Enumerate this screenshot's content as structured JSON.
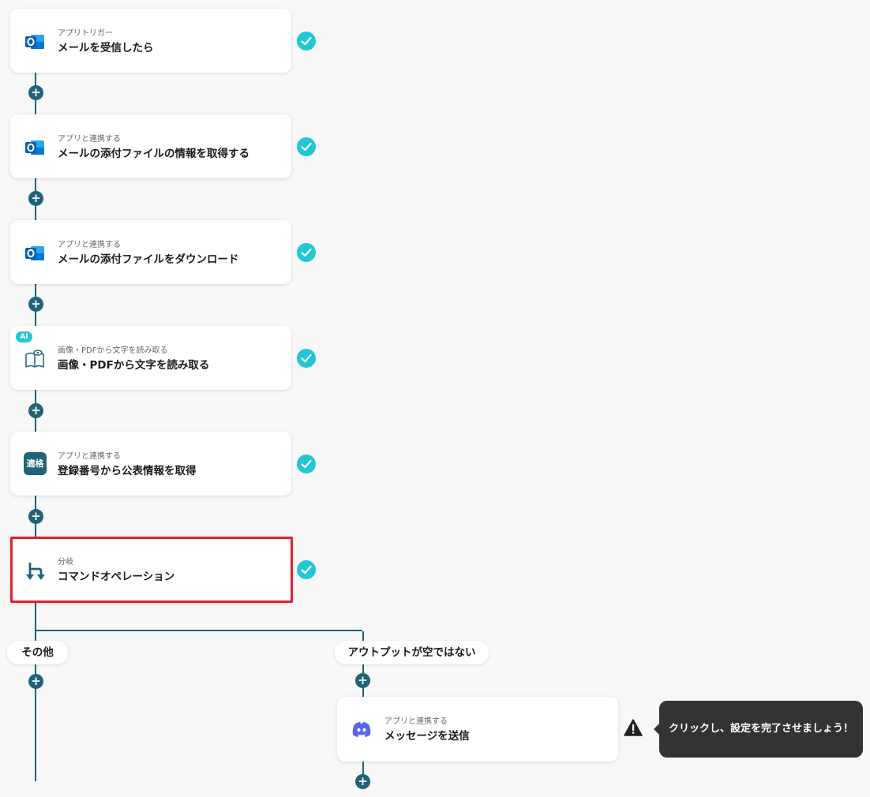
{
  "steps": [
    {
      "subtitle": "アプリトリガー",
      "title": "メールを受信したら",
      "icon": "outlook-icon"
    },
    {
      "subtitle": "アプリと連携する",
      "title": "メールの添付ファイルの情報を取得する",
      "icon": "outlook-icon"
    },
    {
      "subtitle": "アプリと連携する",
      "title": "メールの添付ファイルをダウンロード",
      "icon": "outlook-icon"
    },
    {
      "subtitle": "画像・PDFから文字を読み取る",
      "title": "画像・PDFから文字を読み取る",
      "icon": "ocr-book-icon",
      "badge": "AI"
    },
    {
      "subtitle": "アプリと連携する",
      "title": "登録番号から公表情報を取得",
      "icon": "invoice-app-icon",
      "icon_text": "適格"
    },
    {
      "subtitle": "分岐",
      "title": "コマンドオペレーション",
      "icon": "branch-icon"
    }
  ],
  "branches": {
    "left_label": "その他",
    "right_label": "アウトプットが空ではない"
  },
  "branch_step": {
    "subtitle": "アプリと連携する",
    "title": "メッセージを送信",
    "icon": "discord-icon"
  },
  "tooltip": {
    "text": "クリックし、設定を完了させましょう！"
  },
  "colors": {
    "line": "#1f6378",
    "check": "#22c7d6",
    "selected_border": "#e0202e",
    "tooltip_bg": "#333333",
    "discord": "#5865f2"
  }
}
